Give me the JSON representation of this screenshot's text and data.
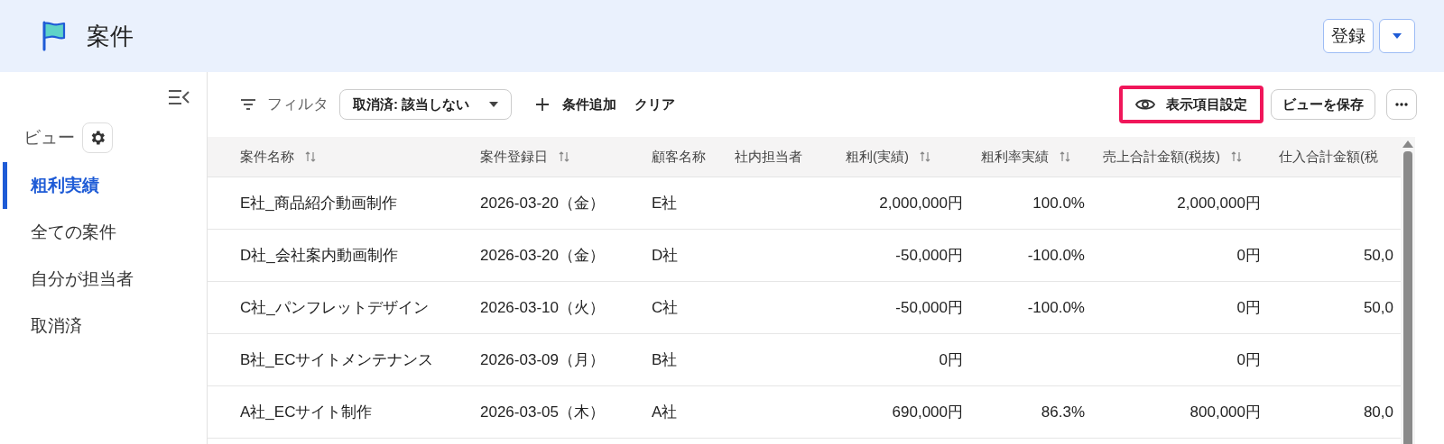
{
  "header": {
    "title": "案件",
    "actions": [
      {
        "kind": "text",
        "label": "登録"
      },
      {
        "kind": "caret"
      }
    ]
  },
  "sidebar": {
    "view_label": "ビュー",
    "items": [
      {
        "label": "粗利実績",
        "selected": true
      },
      {
        "label": "全ての案件",
        "selected": false
      },
      {
        "label": "自分が担当者",
        "selected": false
      },
      {
        "label": "取消済",
        "selected": false
      }
    ]
  },
  "toolbar": {
    "filter_label": "フィルタ",
    "filter_chip": "取消済: 該当しない",
    "add_condition": "条件追加",
    "clear": "クリア",
    "display_settings": {
      "label": "表示項目設定",
      "highlighted": true
    },
    "save_view": "ビューを保存"
  },
  "table": {
    "columns": [
      {
        "label": "案件名称",
        "sortable": true
      },
      {
        "label": "案件登録日",
        "sortable": true
      },
      {
        "label": "顧客名称",
        "sortable": false
      },
      {
        "label": "社内担当者",
        "sortable": false
      },
      {
        "label": "粗利(実績)",
        "sortable": true
      },
      {
        "label": "粗利率実績",
        "sortable": true
      },
      {
        "label": "売上合計金額(税抜)",
        "sortable": true
      },
      {
        "label": "仕入合計金額(税",
        "sortable": false
      }
    ],
    "rows": [
      [
        "E社_商品紹介動画制作",
        "2026-03-20（金）",
        "E社",
        "",
        "2,000,000円",
        "100.0%",
        "2,000,000円",
        ""
      ],
      [
        "D社_会社案内動画制作",
        "2026-03-20（金）",
        "D社",
        "",
        "-50,000円",
        "-100.0%",
        "0円",
        "50,0"
      ],
      [
        "C社_パンフレットデザイン",
        "2026-03-10（火）",
        "C社",
        "",
        "-50,000円",
        "-100.0%",
        "0円",
        "50,0"
      ],
      [
        "B社_ECサイトメンテナンス",
        "2026-03-09（月）",
        "B社",
        "",
        "0円",
        "",
        "0円",
        ""
      ],
      [
        "A社_ECサイト制作",
        "2026-03-05（木）",
        "A社",
        "",
        "690,000円",
        "86.3%",
        "800,000円",
        "80,0"
      ]
    ]
  }
}
